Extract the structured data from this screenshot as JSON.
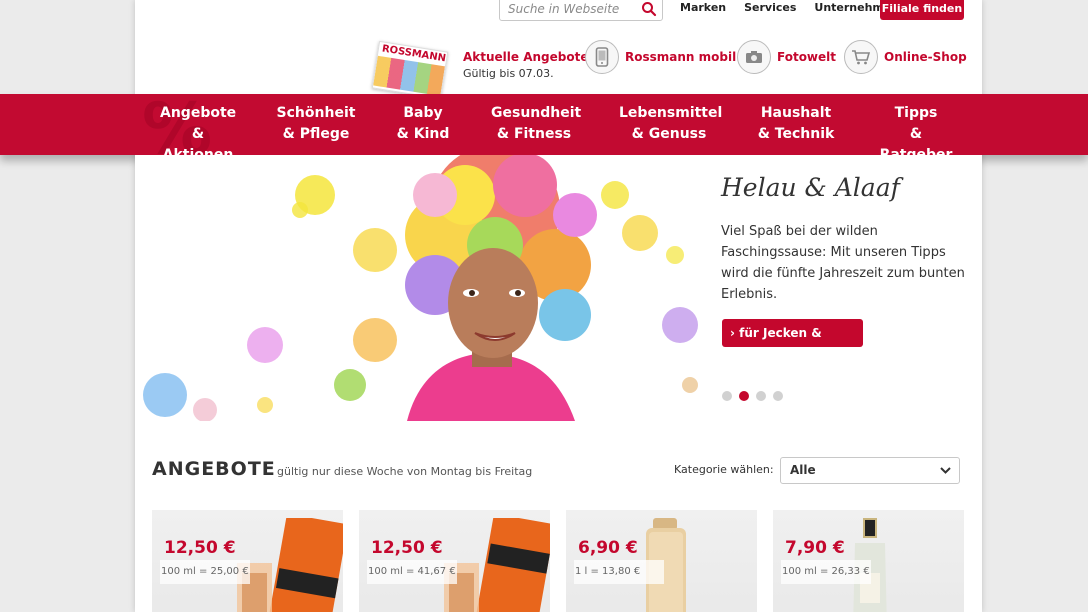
{
  "header": {
    "search_placeholder": "Suche in Webseite",
    "toplinks": [
      "Marken",
      "Services",
      "Unternehmen"
    ],
    "filiale_button": "Filiale finden",
    "prospekt_logo": "ROSSMANN",
    "aktuelle_title": "Aktuelle Angebote",
    "aktuelle_sub": "Gültig bis 07.03.",
    "features": [
      {
        "label": "Rossmann mobil",
        "icon": "mobile-phone-icon"
      },
      {
        "label": "Fotowelt",
        "icon": "camera-icon"
      },
      {
        "label": "Online-Shop",
        "icon": "shopping-cart-icon"
      }
    ]
  },
  "nav": {
    "percent_glyph": "%",
    "items": [
      {
        "l1": "Angebote",
        "l2": "& Aktionen"
      },
      {
        "l1": "Schönheit",
        "l2": "& Pflege"
      },
      {
        "l1": "Baby",
        "l2": "& Kind"
      },
      {
        "l1": "Gesundheit",
        "l2": "& Fitness"
      },
      {
        "l1": "Lebensmittel",
        "l2": "& Genuss"
      },
      {
        "l1": "Haushalt",
        "l2": "& Technik"
      },
      {
        "l1": "Tipps",
        "l2": "& Ratgeber"
      }
    ]
  },
  "hero": {
    "title": "Helau & Alaaf",
    "text": "Viel Spaß bei der wilden Faschingssause: Mit unseren Tipps wird die fünfte Jahreszeit zum bunten Erlebnis.",
    "button": "für Jecken & Narren",
    "button_icon": "chevron-right-icon",
    "slides": 4,
    "active_slide": 2
  },
  "offers": {
    "title": "ANGEBOTE",
    "subtitle": "gültig nur diese Woche von Montag bis Freitag",
    "category_label": "Kategorie wählen:",
    "category_value": "Alle",
    "products": [
      {
        "price": "12,50 €",
        "unit": "100 ml = 25,00 €"
      },
      {
        "price": "12,50 €",
        "unit": "100 ml = 41,67 €"
      },
      {
        "price": "6,90 €",
        "unit": "1 l = 13,80 €"
      },
      {
        "price": "7,90 €",
        "unit": "100 ml = 26,33 €"
      }
    ]
  },
  "colors": {
    "brand_red": "#c4072d",
    "nav_red": "#c20a31"
  }
}
